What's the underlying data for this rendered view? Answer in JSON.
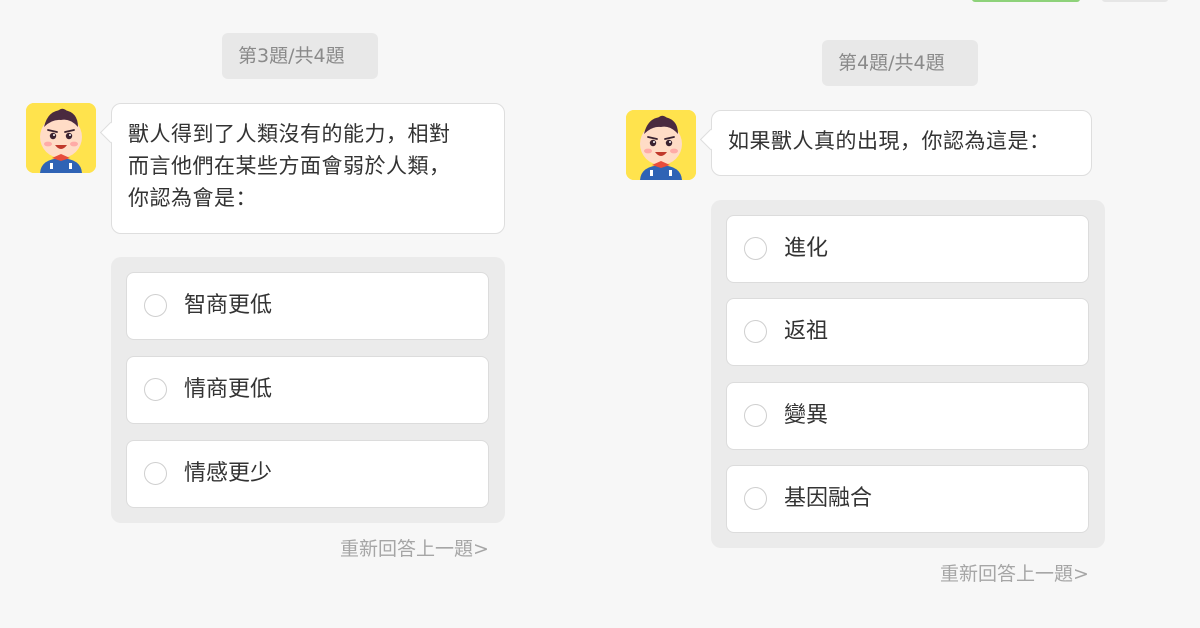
{
  "colors": {
    "page_background": "#f7f7f7",
    "counter_background": "#e8e8e8",
    "options_background": "#ebebeb",
    "avatar_background": "#ffe34d",
    "muted_text": "#a6a6a6",
    "top_tab_active": "#8ed27a"
  },
  "questions": [
    {
      "counter": "第3題/共4題",
      "avatar_icon": "boy-mascot-icon",
      "prompt": "獸人得到了人類沒有的能力，相對\n而言他們在某些方面會弱於人類，\n你認為會是：",
      "options": [
        {
          "label": "智商更低"
        },
        {
          "label": "情商更低"
        },
        {
          "label": "情感更少"
        }
      ],
      "redo_label": "重新回答上一題>"
    },
    {
      "counter": "第4題/共4題",
      "avatar_icon": "boy-mascot-icon",
      "prompt": "如果獸人真的出現，你認為這是：",
      "options": [
        {
          "label": "進化"
        },
        {
          "label": "返祖"
        },
        {
          "label": "變異"
        },
        {
          "label": "基因融合"
        }
      ],
      "redo_label": "重新回答上一題>"
    }
  ]
}
